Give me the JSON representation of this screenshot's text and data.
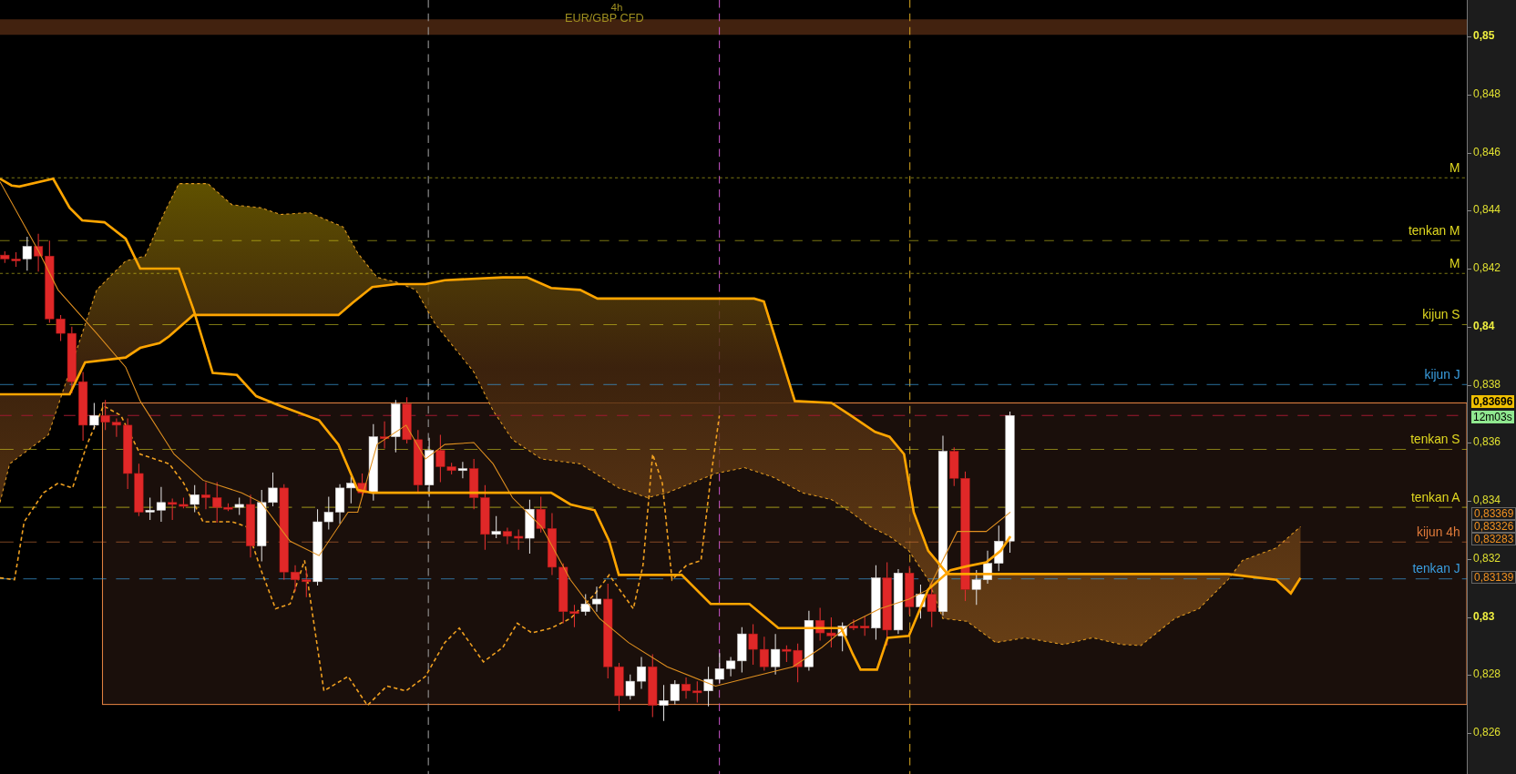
{
  "chart": {
    "timeframe": "4h",
    "symbol": "EUR/GBP CFD"
  },
  "levels": [
    {
      "label": "M",
      "color": "#e0d820"
    },
    {
      "label": "tenkan M",
      "color": "#e0d820"
    },
    {
      "label": "M",
      "color": "#e0d820"
    },
    {
      "label": "kijun S",
      "color": "#e0d820"
    },
    {
      "label": "kijun J",
      "color": "#3a9ee0"
    },
    {
      "label": "tenkan S",
      "color": "#e0d820"
    },
    {
      "label": "tenkan A",
      "color": "#e0d820"
    },
    {
      "label": "kijun 4h",
      "color": "#e07a3a"
    },
    {
      "label": "tenkan J",
      "color": "#3a9ee0"
    }
  ],
  "price_axis": {
    "ticks": [
      {
        "text": "0,85",
        "major": true
      },
      {
        "text": "0,848",
        "major": false
      },
      {
        "text": "0,846",
        "major": false
      },
      {
        "text": "0,844",
        "major": false
      },
      {
        "text": "0,842",
        "major": false
      },
      {
        "text": "0,84",
        "major": true
      },
      {
        "text": "0,838",
        "major": false
      },
      {
        "text": "0,836",
        "major": false
      },
      {
        "text": "0,834",
        "major": false
      },
      {
        "text": "0,832",
        "major": false
      },
      {
        "text": "0,83",
        "major": true
      },
      {
        "text": "0,828",
        "major": false
      },
      {
        "text": "0,826",
        "major": false
      }
    ],
    "tags": [
      {
        "text": "0,83696",
        "kind": "current"
      },
      {
        "text": "12m03s",
        "kind": "countdown"
      },
      {
        "text": "0,83369",
        "kind": "level"
      },
      {
        "text": "0,83326",
        "kind": "level"
      },
      {
        "text": "0,83283",
        "kind": "level"
      },
      {
        "text": "0,83139",
        "kind": "level"
      }
    ]
  }
}
